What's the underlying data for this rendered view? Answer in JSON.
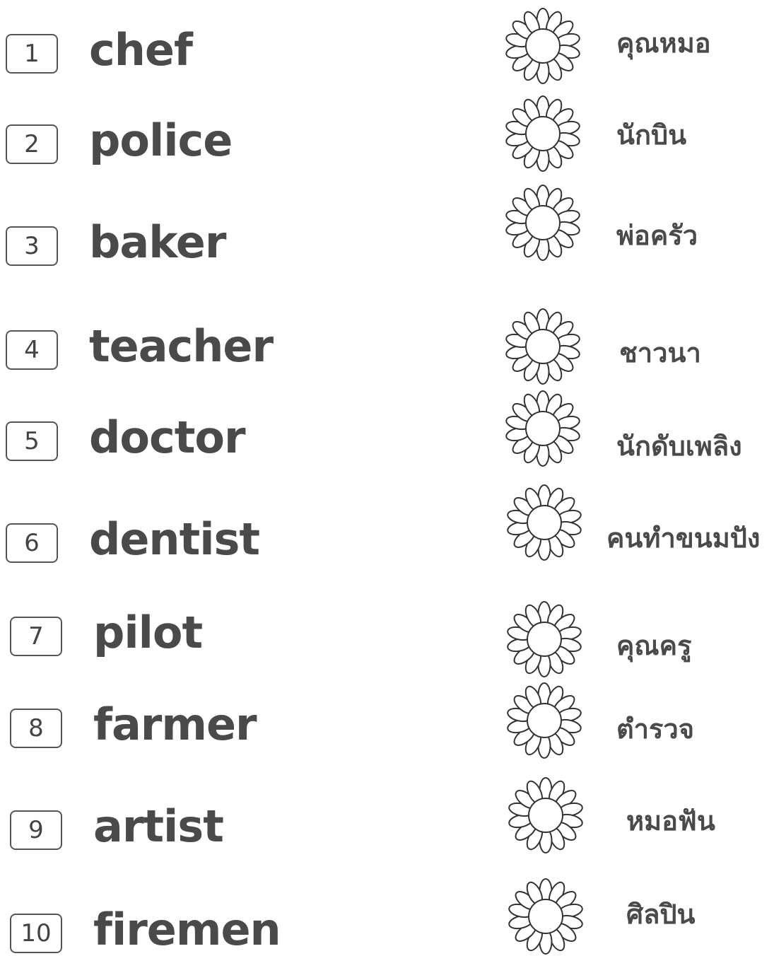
{
  "left_items": [
    {
      "number": "1",
      "word": "chef"
    },
    {
      "number": "2",
      "word": "police"
    },
    {
      "number": "3",
      "word": "baker"
    },
    {
      "number": "4",
      "word": "teacher"
    },
    {
      "number": "5",
      "word": "doctor"
    },
    {
      "number": "6",
      "word": "dentist"
    },
    {
      "number": "7",
      "word": "pilot"
    },
    {
      "number": "8",
      "word": "farmer"
    },
    {
      "number": "9",
      "word": "artist"
    },
    {
      "number": "10",
      "word": "firemen"
    }
  ],
  "right_items": [
    {
      "thai": "คุณหมอ",
      "icon": "flower-icon"
    },
    {
      "thai": "นักบิน",
      "icon": "flower-icon"
    },
    {
      "thai": "พ่อครัว",
      "icon": "flower-icon"
    },
    {
      "thai": "ชาวนา",
      "icon": "flower-icon"
    },
    {
      "thai": "นักดับเพลิง",
      "icon": "flower-icon"
    },
    {
      "thai": "คนทำขนมปัง",
      "icon": "flower-icon"
    },
    {
      "thai": "คุณครู",
      "icon": "flower-icon"
    },
    {
      "thai": "ตำรวจ",
      "icon": "flower-icon"
    },
    {
      "thai": "หมอฟัน",
      "icon": "flower-icon"
    },
    {
      "thai": "ศิลปิน",
      "icon": "flower-icon"
    }
  ],
  "colors": {
    "text": "#4a4a4a",
    "box_border": "#555555",
    "flower_stroke": "#333333"
  }
}
